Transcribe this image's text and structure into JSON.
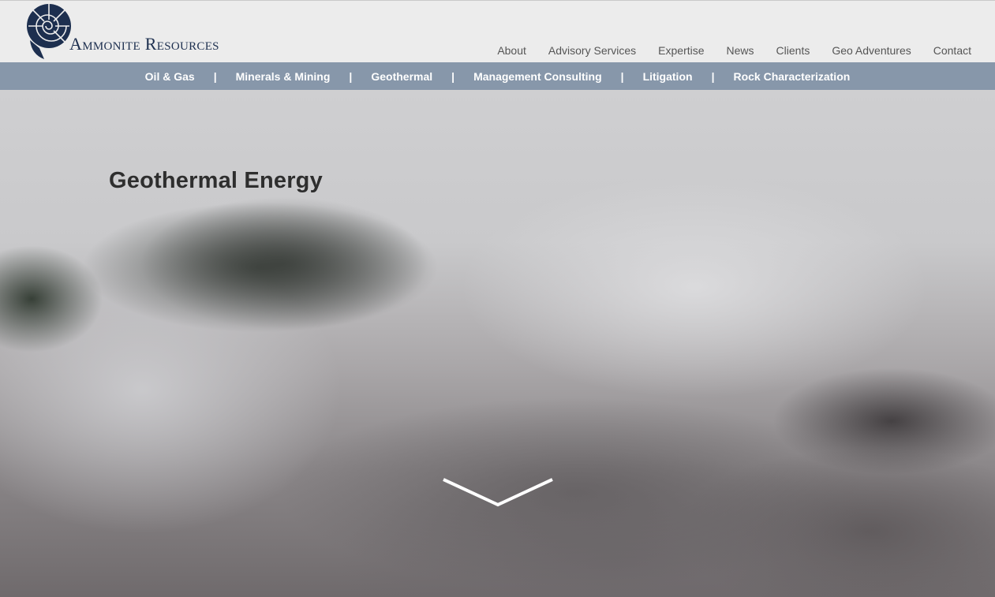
{
  "header": {
    "brand_main": "Ammonite",
    "brand_second": "Resources",
    "logo_icon": "ammonite-shell-icon",
    "brand_color": "#1d2f4f"
  },
  "topnav": {
    "items": [
      "About",
      "Advisory Services",
      "Expertise",
      "News",
      "Clients",
      "Geo Adventures",
      "Contact"
    ]
  },
  "subnav": {
    "bg_color": "#8797aa",
    "items": [
      "Oil & Gas",
      "Minerals & Mining",
      "Geothermal",
      "Management Consulting",
      "Litigation",
      "Rock Characterization"
    ],
    "separator": "|"
  },
  "hero": {
    "title": "Geothermal Energy",
    "scroll_icon": "chevron-down-icon"
  }
}
